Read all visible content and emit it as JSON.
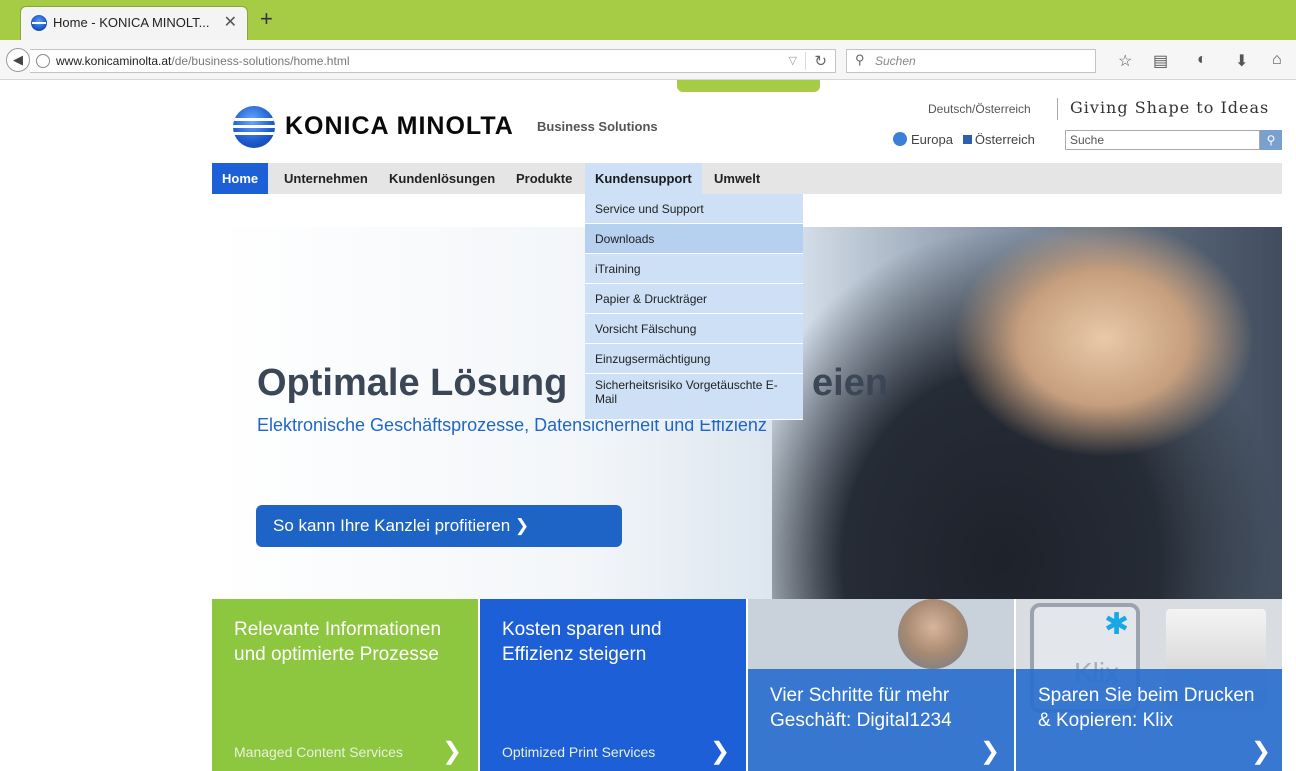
{
  "browser": {
    "tab_title": "Home - KONICA MINOLT...",
    "tab_close": "✕",
    "new_tab": "+",
    "url_host": "www.konicaminolta.at",
    "url_path": "/de/business-solutions/home.html",
    "search_placeholder": "Suchen"
  },
  "header": {
    "logo_text": "KONICA MINOLTA",
    "business": "Business Solutions",
    "language": "Deutsch/Österreich",
    "tagline": "Giving Shape to Ideas",
    "region_europa": "Europa",
    "region_country": "Österreich",
    "search_value": "Suche"
  },
  "nav": {
    "items": [
      "Home",
      "Unternehmen",
      "Kundenlösungen",
      "Produkte",
      "Kundensupport",
      "Umwelt"
    ]
  },
  "dropdown": {
    "items": [
      "Service und Support",
      "Downloads",
      "iTraining",
      "Papier & Druckträger",
      "Vorsicht Fälschung",
      "Einzugsermächtigung",
      "Sicherheitsrisiko Vorgetäuschte E-Mail"
    ]
  },
  "hero": {
    "title": "Optimale Lösung",
    "title_tail": "eien",
    "subtitle": "Elektronische Geschäftsprozesse, Datensicherheit und Effizienz",
    "cta": "So kann Ihre Kanzlei profitieren ❯"
  },
  "tiles": [
    {
      "title": "Relevante Informationen und optimierte Prozesse",
      "link": "Managed Content Services",
      "arrow": "❯"
    },
    {
      "title": "Kosten sparen und Effizienz steigern",
      "link": "Optimized Print Services",
      "arrow": "❯"
    },
    {
      "title": "Vier Schritte für mehr Geschäft: Digital1234",
      "arrow": "❯"
    },
    {
      "title": "Sparen Sie beim Drucken & Kopieren: Klix",
      "arrow": "❯",
      "klix_word": "Klix"
    }
  ],
  "colors": {
    "green": "#8dc63f",
    "blue": "#1c5fd6",
    "chrome_green": "#a6cb45"
  }
}
